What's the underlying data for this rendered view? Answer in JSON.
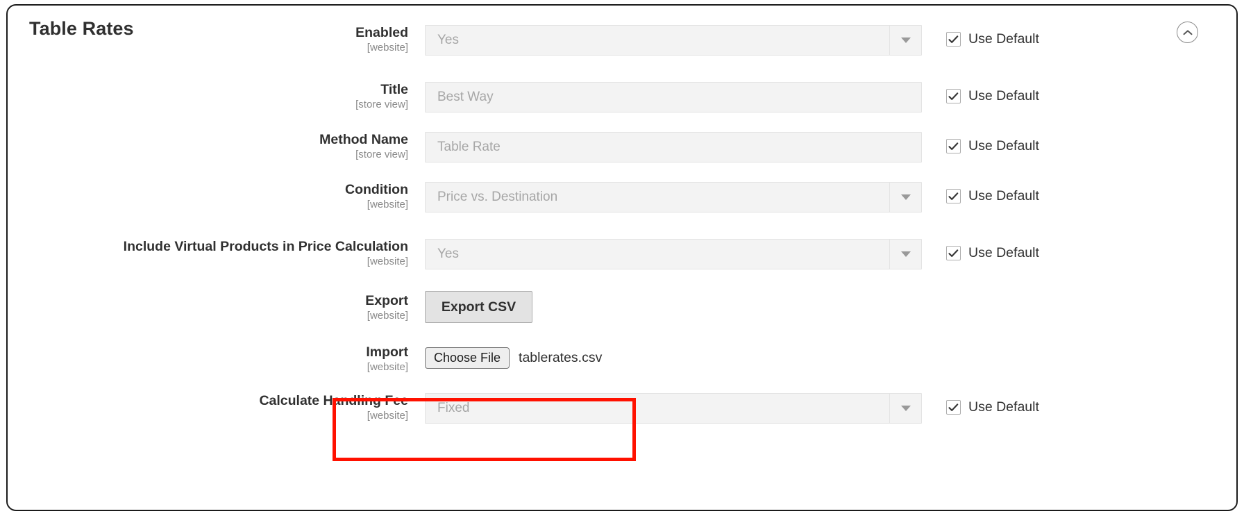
{
  "section": {
    "title": "Table Rates",
    "collapse_icon": "chevron-up-icon"
  },
  "common": {
    "use_default_label": "Use Default",
    "scope_website": "[website]",
    "scope_store_view": "[store view]"
  },
  "colors": {
    "highlight": "#ff1100",
    "field_bg": "#f3f3f3",
    "field_border": "#e3e3e3",
    "text": "#303030",
    "muted": "#8a8a8a",
    "placeholder": "#a6a6a6",
    "card_border": "#1b1b1b"
  },
  "rows": [
    {
      "label": "Enabled",
      "scope": "[website]",
      "control": "select",
      "value": "Yes",
      "use_default": true,
      "checked": true
    },
    {
      "label": "Title",
      "scope": "[store view]",
      "control": "text",
      "value": "Best Way",
      "use_default": true,
      "checked": true
    },
    {
      "label": "Method Name",
      "scope": "[store view]",
      "control": "text",
      "value": "Table Rate",
      "use_default": true,
      "checked": true
    },
    {
      "label": "Condition",
      "scope": "[website]",
      "control": "select",
      "value": "Price vs. Destination",
      "use_default": true,
      "checked": true
    },
    {
      "label": "Include Virtual Products in Price Calculation",
      "scope": "[website]",
      "control": "select",
      "value": "Yes",
      "use_default": true,
      "checked": true
    },
    {
      "label": "Export",
      "scope": "[website]",
      "control": "button",
      "button_label": "Export CSV",
      "use_default": false
    },
    {
      "label": "Import",
      "scope": "[website]",
      "control": "file",
      "choose_label": "Choose File",
      "file_name": "tablerates.csv",
      "use_default": false,
      "highlighted": true
    },
    {
      "label": "Calculate Handling Fee",
      "scope": "[website]",
      "control": "select",
      "value": "Fixed",
      "use_default": true,
      "checked": true
    }
  ]
}
